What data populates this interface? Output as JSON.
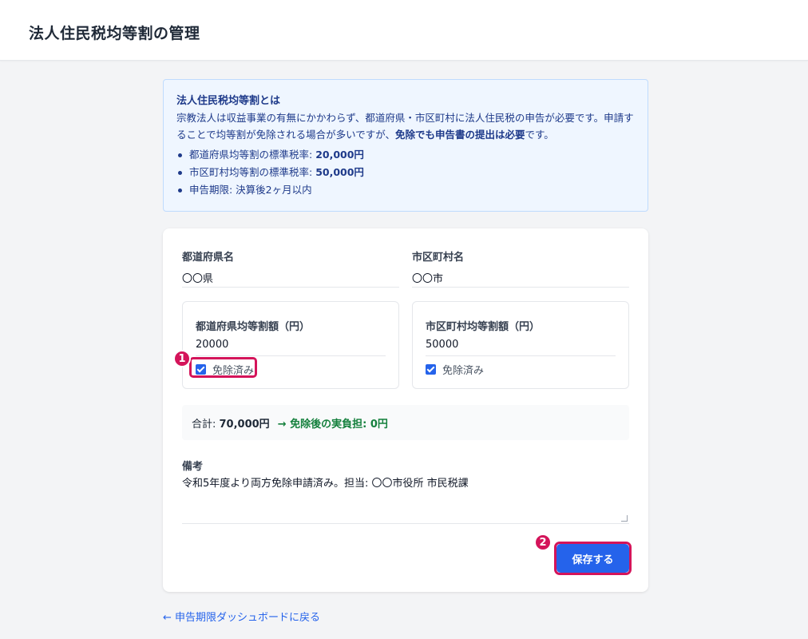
{
  "header": {
    "title": "法人住民税均等割の管理"
  },
  "info": {
    "title": "法人住民税均等割とは",
    "body_1": "宗教法人は収益事業の有無にかかわらず、都道府県・市区町村に法人住民税の申告が必要です。申請することで均等割が免除される場合が多いですが、",
    "body_bold": "免除でも申告書の提出は必要",
    "body_2": "です。",
    "items": [
      {
        "label": "都道府県均等割の標準税率: ",
        "value": "20,000円"
      },
      {
        "label": "市区町村均等割の標準税率: ",
        "value": "50,000円"
      },
      {
        "label": "申告期限: 決算後2ヶ月以内",
        "value": ""
      }
    ]
  },
  "form": {
    "prefecture_label": "都道府県名",
    "prefecture_value": "〇〇県",
    "city_label": "市区町村名",
    "city_value": "〇〇市",
    "pref_amount_label": "都道府県均等割額（円）",
    "pref_amount_value": "20000",
    "city_amount_label": "市区町村均等割額（円）",
    "city_amount_value": "50000",
    "exempt_label": "免除済み",
    "total_prefix": "合計: ",
    "total_value": "70,000円",
    "total_after": "→ 免除後の実負担: 0円",
    "notes_label": "備考",
    "notes_value": "令和5年度より両方免除申請済み。担当: 〇〇市役所 市民税課",
    "save_label": "保存する"
  },
  "annotations": {
    "step1": "1",
    "step2": "2"
  },
  "footer": {
    "back_link": "← 申告期限ダッシュボードに戻る"
  }
}
